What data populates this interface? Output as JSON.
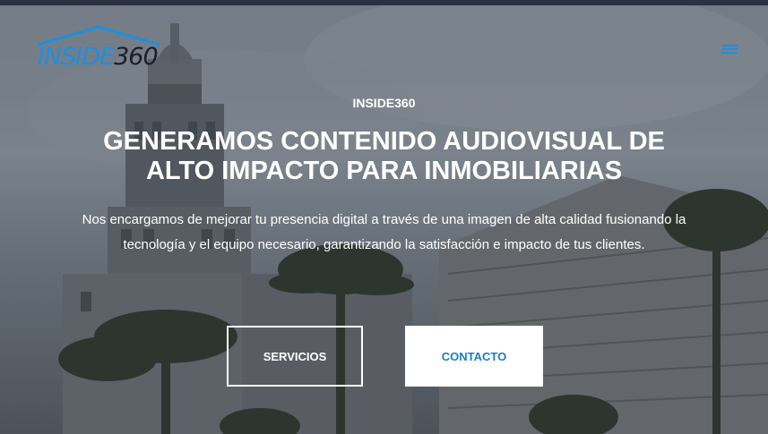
{
  "brand": {
    "logo_text_1": "INSIDE",
    "logo_text_2": "360",
    "logo_icon": "house-roof-icon"
  },
  "header": {
    "menu_icon": "hamburger-menu-icon"
  },
  "hero": {
    "eyebrow": "INSIDE360",
    "headline": "GENERAMOS CONTENIDO AUDIOVISUAL DE ALTO IMPACTO PARA INMOBILIARIAS",
    "description": "Nos encargamos de mejorar tu presencia digital a través de una imagen de alta calidad fusionando la tecnología y el equipo necesario, garantizando la satisfacción e impacto de tus clientes.",
    "background": "city-buildings-palm-trees-photo"
  },
  "actions": {
    "servicios_label": "SERVICIOS",
    "contacto_label": "CONTACTO"
  },
  "colors": {
    "accent": "#1d8fe0",
    "button_text": "#1a7cc4",
    "top_strip": "#2c3040"
  }
}
